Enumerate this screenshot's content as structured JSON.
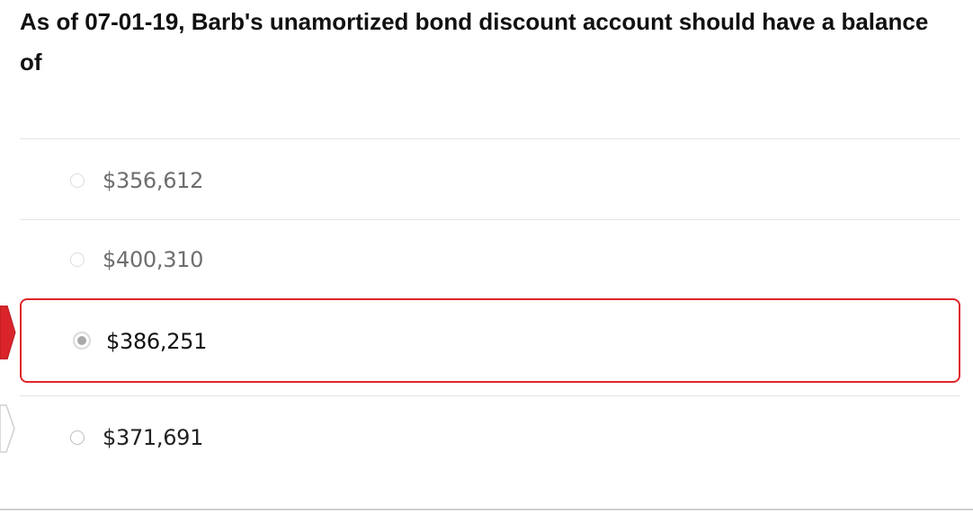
{
  "question": {
    "text": "As of 07-01-19, Barb's unamortized bond discount account should have a balance of"
  },
  "options": [
    {
      "label": "$356,612",
      "state": "unselected"
    },
    {
      "label": "$400,310",
      "state": "unselected"
    },
    {
      "label": "$386,251",
      "state": "selected"
    },
    {
      "label": "$371,691",
      "state": "unselected"
    }
  ],
  "colors": {
    "selected_border": "#e0252b",
    "incorrect_marker": "#d9242a",
    "neutral_marker": "#ffffff"
  },
  "icons": {
    "selected_marker": "red-arrow-marker-icon",
    "next_marker": "white-arrow-marker-icon"
  }
}
